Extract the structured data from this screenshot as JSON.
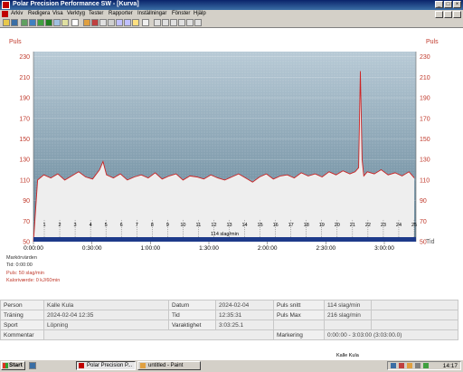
{
  "window": {
    "title": "Polar Precision Performance SW - [Kurva]",
    "controls": [
      "_",
      "□",
      "×"
    ]
  },
  "menu": [
    "Arkiv",
    "Redigera",
    "Visa",
    "Verktyg",
    "Tester",
    "Rapporter",
    "Inställningar",
    "Fönster",
    "Hjälp"
  ],
  "chart_data": {
    "type": "line",
    "ylabel_left": "Puls",
    "ylabel_right": "Puls",
    "y_unit_right": "Tid",
    "ylim": [
      50,
      235
    ],
    "yticks": [
      50,
      70,
      90,
      110,
      130,
      150,
      170,
      190,
      210,
      230
    ],
    "xlim_seconds": [
      0,
      11000
    ],
    "xticks": [
      "0:00:00",
      "0:30:00",
      "1:00:00",
      "1:30:00",
      "2:00:00",
      "2:30:00",
      "3:00:00"
    ],
    "laps": [
      "1",
      "2",
      "3",
      "4",
      "5",
      "6",
      "7",
      "8",
      "9",
      "10",
      "11",
      "12",
      "13",
      "14",
      "15",
      "16",
      "17",
      "18",
      "19",
      "20",
      "21",
      "22",
      "23",
      "24",
      "25"
    ],
    "lap_band_label": "114 slag/min",
    "grid": true,
    "series": [
      {
        "color": "#cc2222",
        "t": [
          0,
          120,
          300,
          500,
          700,
          900,
          1100,
          1300,
          1500,
          1700,
          1900,
          2000,
          2100,
          2300,
          2500,
          2700,
          2900,
          3100,
          3300,
          3500,
          3700,
          3900,
          4100,
          4300,
          4500,
          4700,
          4900,
          5100,
          5300,
          5500,
          5700,
          5900,
          6100,
          6300,
          6500,
          6700,
          6900,
          7100,
          7300,
          7500,
          7700,
          7900,
          8100,
          8300,
          8500,
          8700,
          8900,
          9100,
          9250,
          9350,
          9400,
          9450,
          9500,
          9600,
          9800,
          10000,
          10200,
          10400,
          10600,
          10800,
          10950
        ],
        "hr": [
          50,
          110,
          115,
          112,
          116,
          110,
          114,
          118,
          113,
          111,
          120,
          128,
          115,
          112,
          116,
          110,
          113,
          115,
          112,
          117,
          111,
          114,
          116,
          110,
          114,
          113,
          111,
          115,
          112,
          110,
          113,
          116,
          112,
          108,
          113,
          116,
          111,
          114,
          115,
          112,
          117,
          114,
          116,
          113,
          118,
          115,
          119,
          116,
          118,
          122,
          216,
          130,
          114,
          118,
          116,
          120,
          115,
          117,
          114,
          118,
          112
        ]
      }
    ]
  },
  "marker": {
    "heading": "Markörvärden",
    "time": "Tid: 0:00:00",
    "pulse": "Puls: 50 slag/min",
    "calories": "Kaloriværde: 0 kJ/60min"
  },
  "info": {
    "person_label": "Person",
    "person": "Kalle Kula",
    "datum_label": "Datum",
    "datum": "2024-02-04",
    "puls_snitt_label": "Puls snitt",
    "puls_snitt": "114 slag/min",
    "traning_label": "Träning",
    "traning": "2024-02-04 12:35",
    "tid_label": "Tid",
    "tid": "12:35:31",
    "puls_max_label": "Puls Max",
    "puls_max": "216 slag/min",
    "sport_label": "Sport",
    "sport": "Löpning",
    "varaktighet_label": "Varaktighet",
    "varaktighet": "3:03:25.1",
    "kommentar_label": "Kommentar",
    "markering_label": "Markering",
    "markering": "0:00:00 - 3:03:00 (3:03:00.0)"
  },
  "status_file": "Kalle Kula",
  "taskbar": {
    "start_label": "Start",
    "items": [
      "Polar Precision P...",
      "untitled - Paint"
    ],
    "clock": "14:17"
  },
  "colors": {
    "line": "#cc2222",
    "plot_top": "#6f8ea0",
    "plot_bottom": "#eeeeee",
    "accent": "#0a246a"
  }
}
